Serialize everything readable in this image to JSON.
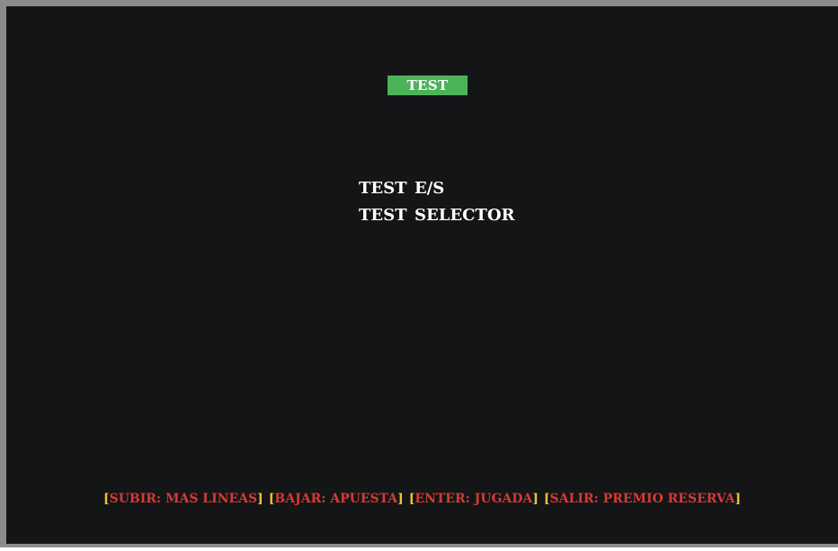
{
  "header": {
    "title": "TEST"
  },
  "menu": {
    "items": [
      {
        "word": "TEST",
        "target": "E/S"
      },
      {
        "word": "TEST",
        "target": "SELECTOR"
      }
    ]
  },
  "footer": {
    "open_bracket": "[",
    "close_bracket": "]",
    "hints": [
      {
        "text": "SUBIR: MAS LINEAS"
      },
      {
        "text": "BAJAR: APUESTA"
      },
      {
        "text": "ENTER: JUGADA"
      },
      {
        "text": "SALIR: PREMIO RESERVA"
      }
    ]
  },
  "colors": {
    "screen_background": "#141517",
    "bezel": "#8c8c8c",
    "title_badge": "#4db35a",
    "menu_text": "#ffffff",
    "hint_bracket": "#e8c23a",
    "hint_text": "#d63a32"
  }
}
